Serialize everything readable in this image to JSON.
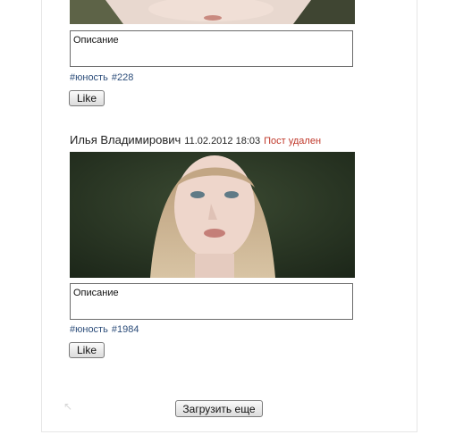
{
  "posts": [
    {
      "description": "Описание",
      "tags": [
        "#юность",
        "#228"
      ],
      "like_label": "Like"
    },
    {
      "author": "Илья Владимирович",
      "timestamp": "11.02.2012 18:03",
      "status": "Пост удален",
      "description": "Описание",
      "tags": [
        "#юность",
        "#1984"
      ],
      "like_label": "Like"
    }
  ],
  "footer": {
    "load_more_label": "Загрузить еще"
  },
  "colors": {
    "tag_link": "#2c4d7a",
    "deleted_status": "#c0392b"
  }
}
